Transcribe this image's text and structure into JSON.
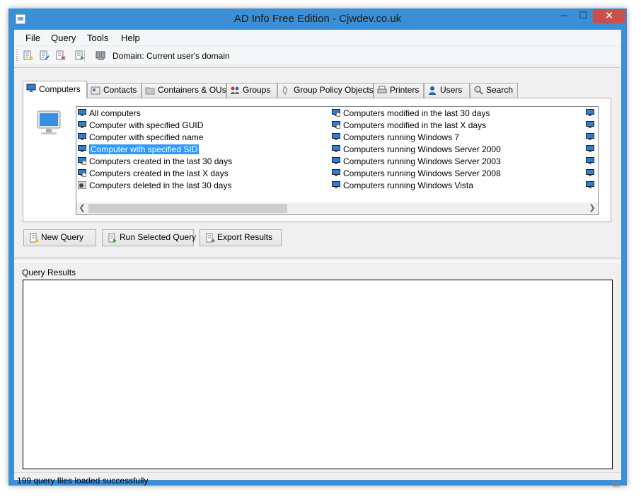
{
  "window": {
    "title": "AD Info Free Edition - Cjwdev.co.uk",
    "minimize": "─",
    "maximize": "☐",
    "close": "✕"
  },
  "menu": [
    "File",
    "Query",
    "Tools",
    "Help"
  ],
  "toolbar": {
    "domain_label": "Domain: Current user's domain"
  },
  "tabs": [
    {
      "label": "Computers",
      "icon": "computer-icon",
      "active": true
    },
    {
      "label": "Contacts",
      "icon": "contact-icon"
    },
    {
      "label": "Containers & OUs",
      "icon": "folder-icon"
    },
    {
      "label": "Groups",
      "icon": "group-icon"
    },
    {
      "label": "Group Policy Objects",
      "icon": "policy-icon"
    },
    {
      "label": "Printers",
      "icon": "printer-icon"
    },
    {
      "label": "Users",
      "icon": "user-icon"
    },
    {
      "label": "Search",
      "icon": "search-icon"
    }
  ],
  "queries": {
    "col1": [
      "All computers",
      "Computer with specified GUID",
      "Computer with specified name",
      "Computer with specified SID",
      "Computers created in the last 30 days",
      "Computers created in the last X days",
      "Computers deleted in the last 30 days"
    ],
    "col2": [
      "Computers modified in the last 30 days",
      "Computers modified in the last X days",
      "Computers running Windows 7",
      "Computers running Windows Server 2000",
      "Computers running Windows Server 2003",
      "Computers running Windows Server 2008",
      "Computers running Windows Vista"
    ],
    "selected": "Computer with specified SID"
  },
  "buttons": {
    "new_query": "New Query",
    "run_selected": "Run Selected Query",
    "export": "Export Results"
  },
  "results_label": "Query Results",
  "status": "199 query files loaded successfully",
  "colors": {
    "titlebar": "#3a8fd6",
    "selection": "#3399ff",
    "close": "#c7504a"
  }
}
